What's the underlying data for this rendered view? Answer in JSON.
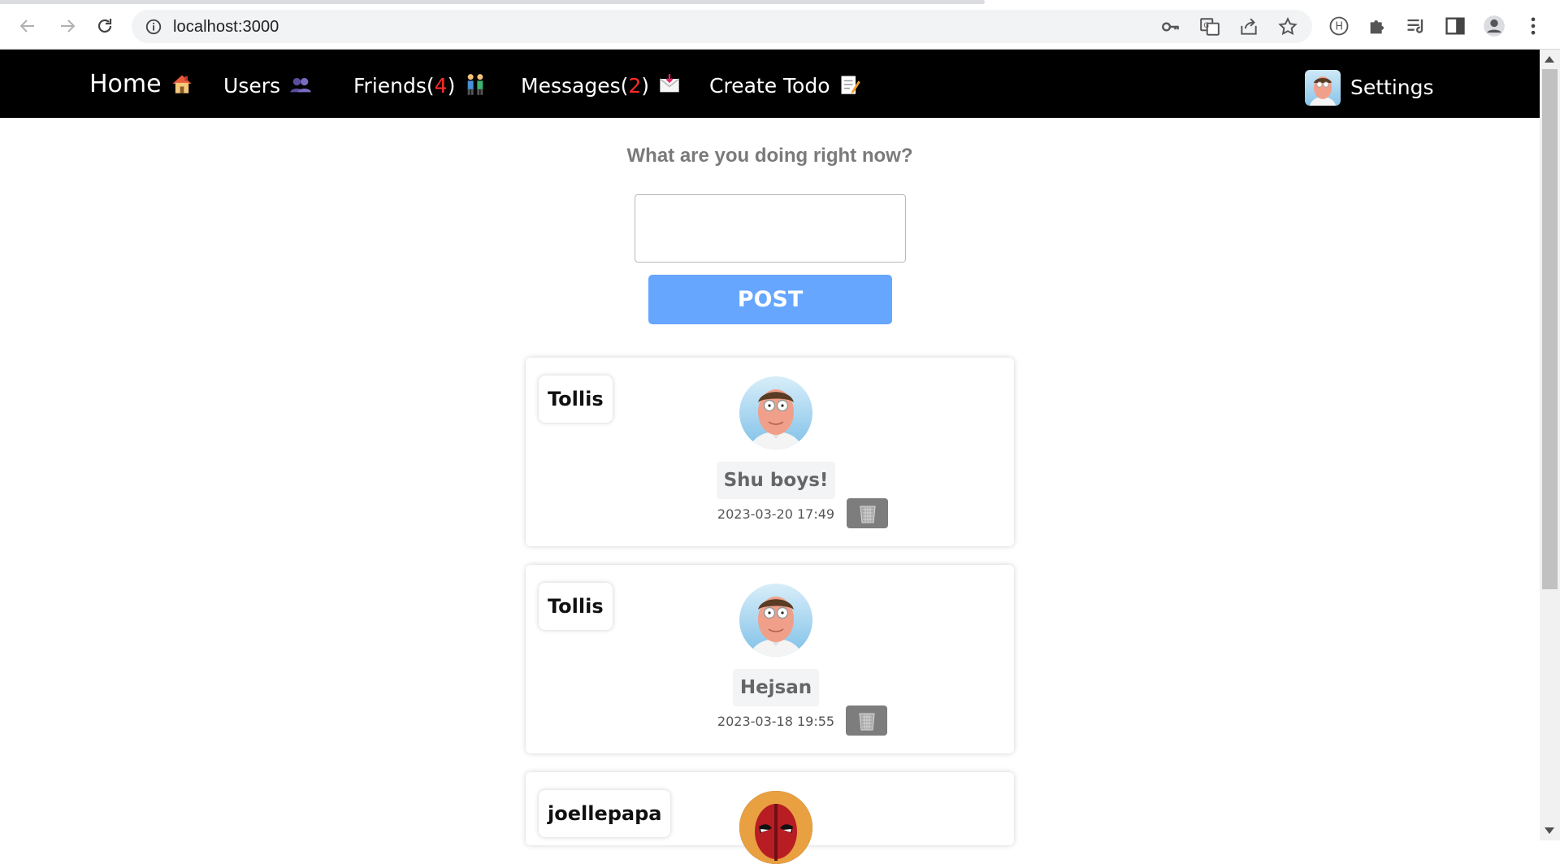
{
  "browser": {
    "url": "localhost:3000"
  },
  "navbar": {
    "home": "Home",
    "users": "Users",
    "friends_label": "Friends(",
    "friends_count": "4",
    "friends_close": ")",
    "messages_label": "Messages(",
    "messages_count": "2",
    "messages_close": ")",
    "create_todo": "Create Todo",
    "settings": "Settings"
  },
  "composer": {
    "question": "What are you doing right now?",
    "post_label": "POST"
  },
  "posts": [
    {
      "author": "Tollis",
      "message": "Shu boys!",
      "timestamp": "2023-03-20 17:49"
    },
    {
      "author": "Tollis",
      "message": "Hejsan",
      "timestamp": "2023-03-18 19:55"
    },
    {
      "author": "joellepapa"
    }
  ],
  "colors": {
    "navbar_bg": "#000000",
    "badge_red": "#ff2b2b",
    "post_button": "#66a6ff",
    "delete_button": "#7d7d7d"
  }
}
